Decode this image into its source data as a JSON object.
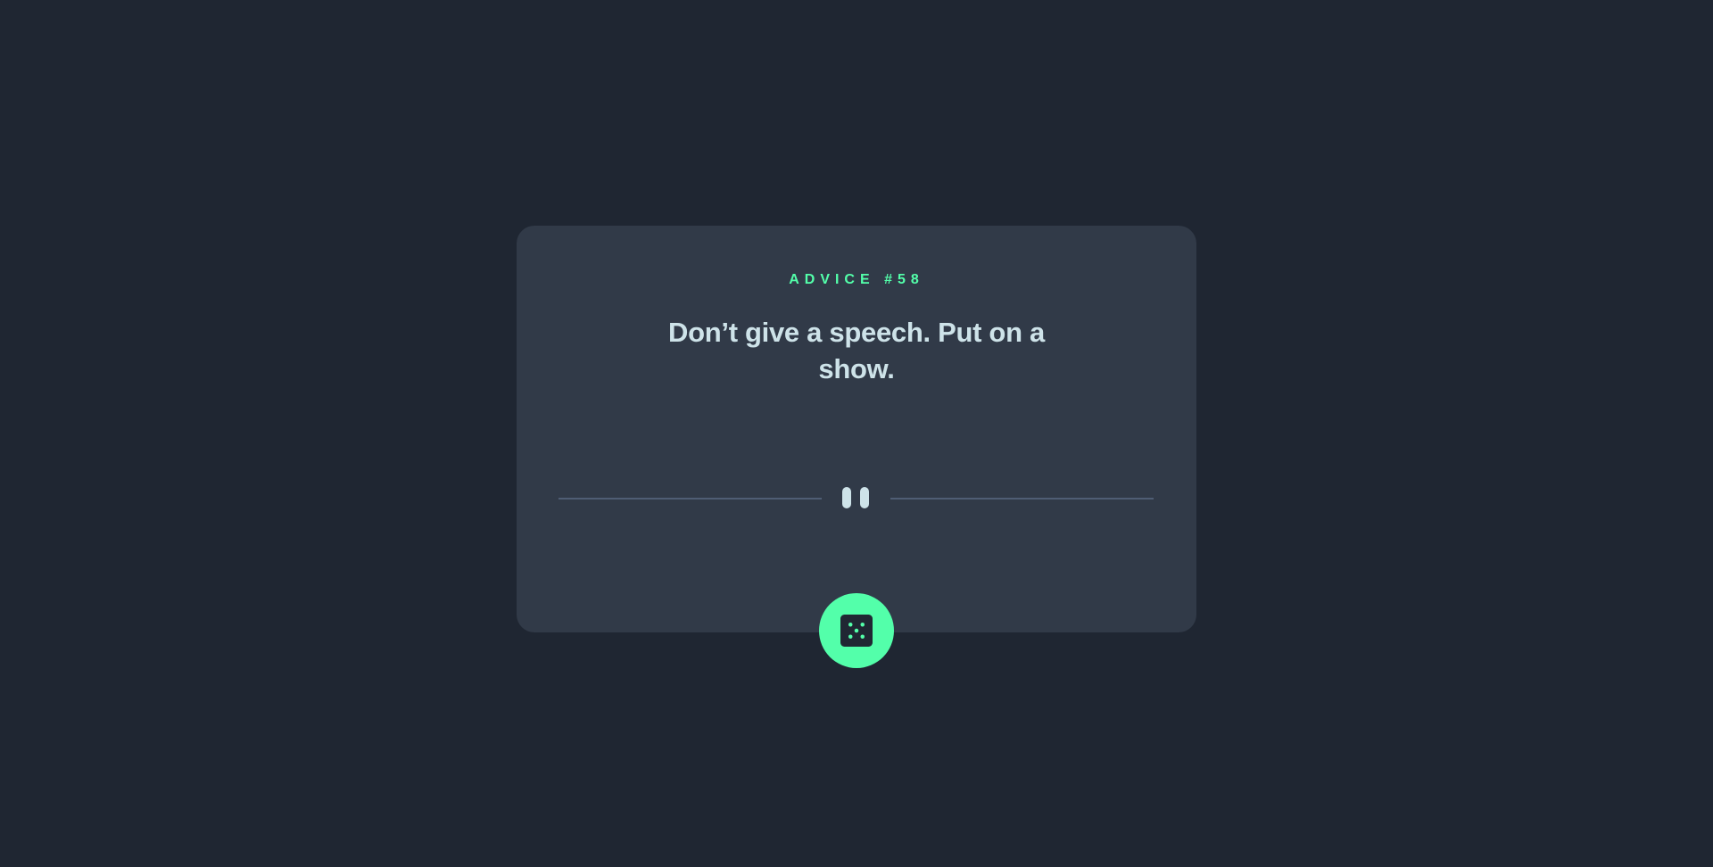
{
  "advice": {
    "id_label": "ADVICE #58",
    "text": "Don’t give a speech. Put on a show."
  },
  "icons": {
    "divider": "pause-icon",
    "button": "dice-icon"
  },
  "colors": {
    "background": "#1f2632",
    "card": "#313a48",
    "accent": "#53ffaa",
    "text": "#cee3e9",
    "divider": "#4f5d74"
  }
}
